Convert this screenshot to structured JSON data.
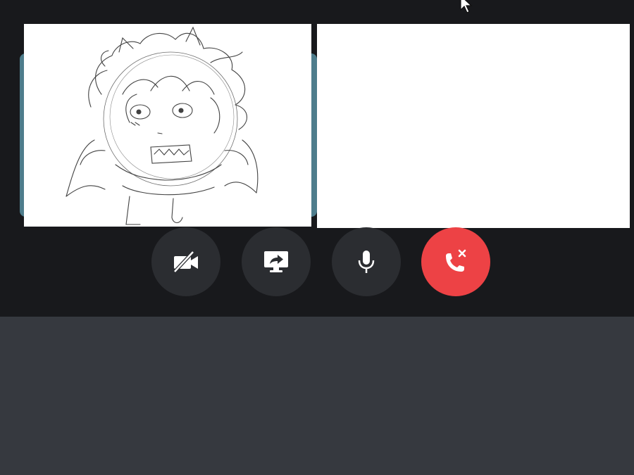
{
  "call": {
    "participants": [
      {
        "tile": "left",
        "stream": "sketch-drawing",
        "speaking_ring_color": "#4e7d8c"
      },
      {
        "tile": "right",
        "stream": "blank-white"
      }
    ]
  },
  "controls": [
    {
      "id": "camera",
      "icon": "camera-off-icon",
      "state": "off"
    },
    {
      "id": "screen-share",
      "icon": "screen-share-icon"
    },
    {
      "id": "microphone",
      "icon": "microphone-icon",
      "state": "on"
    },
    {
      "id": "disconnect",
      "icon": "phone-hangup-icon",
      "color": "#ed4245"
    }
  ],
  "colors": {
    "call_background": "#18191c",
    "panel_background": "#36393f",
    "control_button": "#2b2d31",
    "hangup": "#ed4245"
  }
}
